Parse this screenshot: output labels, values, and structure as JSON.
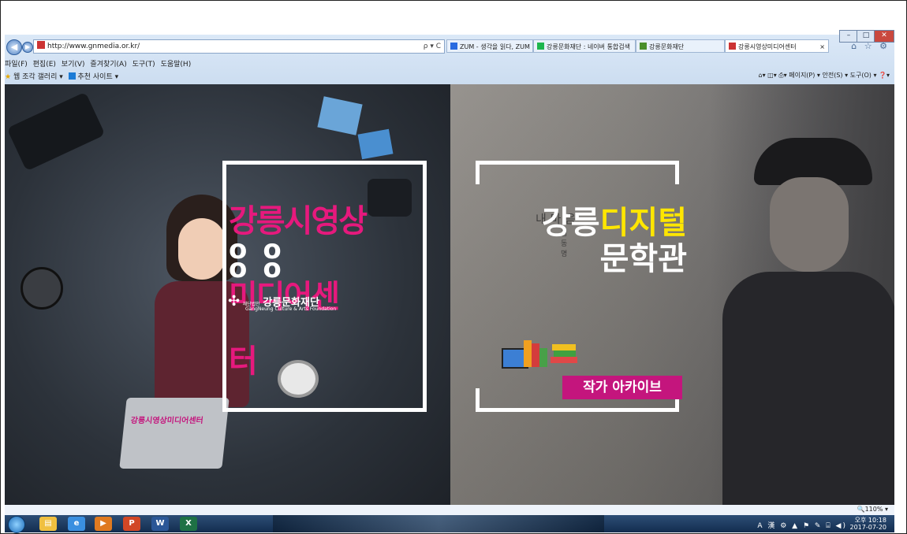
{
  "browser": {
    "url": "http://www.gnmedia.or.kr/",
    "address_controls": "ρ ▾ C",
    "tabs": [
      {
        "label": "ZUM - 생각을 읽다, ZUM",
        "icon_color": "#2a6be0"
      },
      {
        "label": "강릉문화재단 : 네이버 통합검색",
        "icon_color": "#1eb64e"
      },
      {
        "label": "강릉문화재단",
        "icon_color": "#4a8f2a"
      },
      {
        "label": "강릉시영상미디어센터",
        "icon_color": "#c33"
      }
    ],
    "tab_close": "×",
    "window_controls": {
      "minimize": "–",
      "maximize": "□",
      "close": "✕"
    },
    "right_icons": "⌂ ☆ ⚙",
    "menu": [
      "파일(F)",
      "편집(E)",
      "보기(V)",
      "즐겨찾기(A)",
      "도구(T)",
      "도움말(H)"
    ],
    "favorites": [
      "웹 조각 갤러리 ▾",
      "추천 사이트 ▾"
    ],
    "command_bar": [
      "▾",
      "▾",
      "▾ 페이지(P) ▾",
      "안전(S) ▾",
      "도구(O) ▾",
      "▾"
    ],
    "zoom": "🔍110%  ▾"
  },
  "left_panel": {
    "title_lines": [
      "강릉시영상",
      "미디어센",
      "터"
    ],
    "foundation_prefix": "재단법인",
    "foundation_name": "강릉문화재단",
    "foundation_sub": "GangNeung Culture & Arts Foundation",
    "laptop_label": "강릉시영상미디어센터"
  },
  "right_panel": {
    "title_white": "강릉",
    "title_yellow": "디지털",
    "title_line2": "문학관",
    "badge": "작가 아카이브",
    "poem_title": "내 마 음",
    "poem_author": "김 동 명"
  },
  "taskbar": {
    "apps": [
      {
        "icon": "folder-icon",
        "glyph": "▤",
        "color": "#f0c040"
      },
      {
        "icon": "ie-icon",
        "glyph": "e",
        "color": "#3a8fe0"
      },
      {
        "icon": "media-icon",
        "glyph": "▶",
        "color": "#e07a20"
      },
      {
        "icon": "powerpoint-icon",
        "glyph": "P",
        "color": "#d24726"
      },
      {
        "icon": "word-icon",
        "glyph": "W",
        "color": "#2b5797"
      },
      {
        "icon": "excel-icon",
        "glyph": "X",
        "color": "#1e7145"
      }
    ],
    "tray_icons": "A 漢 ⚙ ▲ ⚑ ✎ ⌸ ◀)",
    "time": "오후 10:18",
    "date": "2017-07-20"
  }
}
